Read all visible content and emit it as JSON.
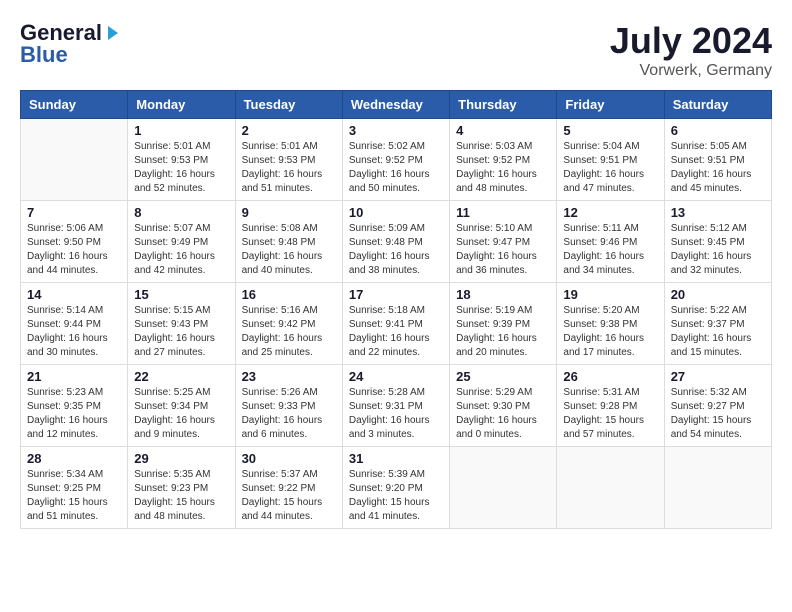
{
  "header": {
    "logo_part1": "General",
    "logo_part2": "Blue",
    "month_year": "July 2024",
    "location": "Vorwerk, Germany"
  },
  "weekdays": [
    "Sunday",
    "Monday",
    "Tuesday",
    "Wednesday",
    "Thursday",
    "Friday",
    "Saturday"
  ],
  "weeks": [
    [
      {
        "day": "",
        "sunrise": "",
        "sunset": "",
        "daylight": ""
      },
      {
        "day": "1",
        "sunrise": "Sunrise: 5:01 AM",
        "sunset": "Sunset: 9:53 PM",
        "daylight": "Daylight: 16 hours and 52 minutes."
      },
      {
        "day": "2",
        "sunrise": "Sunrise: 5:01 AM",
        "sunset": "Sunset: 9:53 PM",
        "daylight": "Daylight: 16 hours and 51 minutes."
      },
      {
        "day": "3",
        "sunrise": "Sunrise: 5:02 AM",
        "sunset": "Sunset: 9:52 PM",
        "daylight": "Daylight: 16 hours and 50 minutes."
      },
      {
        "day": "4",
        "sunrise": "Sunrise: 5:03 AM",
        "sunset": "Sunset: 9:52 PM",
        "daylight": "Daylight: 16 hours and 48 minutes."
      },
      {
        "day": "5",
        "sunrise": "Sunrise: 5:04 AM",
        "sunset": "Sunset: 9:51 PM",
        "daylight": "Daylight: 16 hours and 47 minutes."
      },
      {
        "day": "6",
        "sunrise": "Sunrise: 5:05 AM",
        "sunset": "Sunset: 9:51 PM",
        "daylight": "Daylight: 16 hours and 45 minutes."
      }
    ],
    [
      {
        "day": "7",
        "sunrise": "Sunrise: 5:06 AM",
        "sunset": "Sunset: 9:50 PM",
        "daylight": "Daylight: 16 hours and 44 minutes."
      },
      {
        "day": "8",
        "sunrise": "Sunrise: 5:07 AM",
        "sunset": "Sunset: 9:49 PM",
        "daylight": "Daylight: 16 hours and 42 minutes."
      },
      {
        "day": "9",
        "sunrise": "Sunrise: 5:08 AM",
        "sunset": "Sunset: 9:48 PM",
        "daylight": "Daylight: 16 hours and 40 minutes."
      },
      {
        "day": "10",
        "sunrise": "Sunrise: 5:09 AM",
        "sunset": "Sunset: 9:48 PM",
        "daylight": "Daylight: 16 hours and 38 minutes."
      },
      {
        "day": "11",
        "sunrise": "Sunrise: 5:10 AM",
        "sunset": "Sunset: 9:47 PM",
        "daylight": "Daylight: 16 hours and 36 minutes."
      },
      {
        "day": "12",
        "sunrise": "Sunrise: 5:11 AM",
        "sunset": "Sunset: 9:46 PM",
        "daylight": "Daylight: 16 hours and 34 minutes."
      },
      {
        "day": "13",
        "sunrise": "Sunrise: 5:12 AM",
        "sunset": "Sunset: 9:45 PM",
        "daylight": "Daylight: 16 hours and 32 minutes."
      }
    ],
    [
      {
        "day": "14",
        "sunrise": "Sunrise: 5:14 AM",
        "sunset": "Sunset: 9:44 PM",
        "daylight": "Daylight: 16 hours and 30 minutes."
      },
      {
        "day": "15",
        "sunrise": "Sunrise: 5:15 AM",
        "sunset": "Sunset: 9:43 PM",
        "daylight": "Daylight: 16 hours and 27 minutes."
      },
      {
        "day": "16",
        "sunrise": "Sunrise: 5:16 AM",
        "sunset": "Sunset: 9:42 PM",
        "daylight": "Daylight: 16 hours and 25 minutes."
      },
      {
        "day": "17",
        "sunrise": "Sunrise: 5:18 AM",
        "sunset": "Sunset: 9:41 PM",
        "daylight": "Daylight: 16 hours and 22 minutes."
      },
      {
        "day": "18",
        "sunrise": "Sunrise: 5:19 AM",
        "sunset": "Sunset: 9:39 PM",
        "daylight": "Daylight: 16 hours and 20 minutes."
      },
      {
        "day": "19",
        "sunrise": "Sunrise: 5:20 AM",
        "sunset": "Sunset: 9:38 PM",
        "daylight": "Daylight: 16 hours and 17 minutes."
      },
      {
        "day": "20",
        "sunrise": "Sunrise: 5:22 AM",
        "sunset": "Sunset: 9:37 PM",
        "daylight": "Daylight: 16 hours and 15 minutes."
      }
    ],
    [
      {
        "day": "21",
        "sunrise": "Sunrise: 5:23 AM",
        "sunset": "Sunset: 9:35 PM",
        "daylight": "Daylight: 16 hours and 12 minutes."
      },
      {
        "day": "22",
        "sunrise": "Sunrise: 5:25 AM",
        "sunset": "Sunset: 9:34 PM",
        "daylight": "Daylight: 16 hours and 9 minutes."
      },
      {
        "day": "23",
        "sunrise": "Sunrise: 5:26 AM",
        "sunset": "Sunset: 9:33 PM",
        "daylight": "Daylight: 16 hours and 6 minutes."
      },
      {
        "day": "24",
        "sunrise": "Sunrise: 5:28 AM",
        "sunset": "Sunset: 9:31 PM",
        "daylight": "Daylight: 16 hours and 3 minutes."
      },
      {
        "day": "25",
        "sunrise": "Sunrise: 5:29 AM",
        "sunset": "Sunset: 9:30 PM",
        "daylight": "Daylight: 16 hours and 0 minutes."
      },
      {
        "day": "26",
        "sunrise": "Sunrise: 5:31 AM",
        "sunset": "Sunset: 9:28 PM",
        "daylight": "Daylight: 15 hours and 57 minutes."
      },
      {
        "day": "27",
        "sunrise": "Sunrise: 5:32 AM",
        "sunset": "Sunset: 9:27 PM",
        "daylight": "Daylight: 15 hours and 54 minutes."
      }
    ],
    [
      {
        "day": "28",
        "sunrise": "Sunrise: 5:34 AM",
        "sunset": "Sunset: 9:25 PM",
        "daylight": "Daylight: 15 hours and 51 minutes."
      },
      {
        "day": "29",
        "sunrise": "Sunrise: 5:35 AM",
        "sunset": "Sunset: 9:23 PM",
        "daylight": "Daylight: 15 hours and 48 minutes."
      },
      {
        "day": "30",
        "sunrise": "Sunrise: 5:37 AM",
        "sunset": "Sunset: 9:22 PM",
        "daylight": "Daylight: 15 hours and 44 minutes."
      },
      {
        "day": "31",
        "sunrise": "Sunrise: 5:39 AM",
        "sunset": "Sunset: 9:20 PM",
        "daylight": "Daylight: 15 hours and 41 minutes."
      },
      {
        "day": "",
        "sunrise": "",
        "sunset": "",
        "daylight": ""
      },
      {
        "day": "",
        "sunrise": "",
        "sunset": "",
        "daylight": ""
      },
      {
        "day": "",
        "sunrise": "",
        "sunset": "",
        "daylight": ""
      }
    ]
  ]
}
